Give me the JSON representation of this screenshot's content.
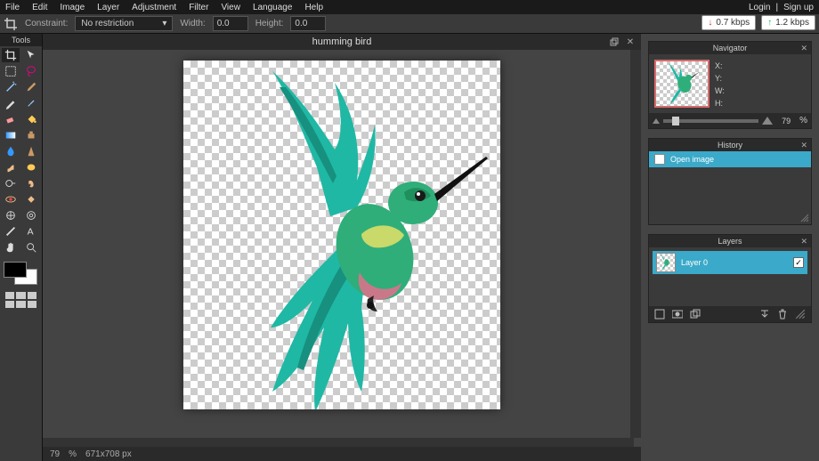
{
  "menu": {
    "items": [
      "File",
      "Edit",
      "Image",
      "Layer",
      "Adjustment",
      "Filter",
      "View",
      "Language",
      "Help"
    ],
    "login": "Login",
    "signup": "Sign up",
    "sep": "|"
  },
  "optionbar": {
    "constraint_label": "Constraint:",
    "constraint_value": "No restriction",
    "width_label": "Width:",
    "width_value": "0.0",
    "height_label": "Height:",
    "height_value": "0.0",
    "down_rate": "0.7 kbps",
    "up_rate": "1.2 kbps"
  },
  "tools": {
    "title": "Tools",
    "items": [
      "crop",
      "move",
      "marquee",
      "lasso",
      "wand",
      "eyedropper",
      "pencil",
      "brush",
      "eraser",
      "paint-bucket",
      "gradient",
      "clone",
      "blur",
      "sharpen",
      "smudge",
      "sponge",
      "dodge",
      "burn",
      "red-eye",
      "spot-heal",
      "bloat",
      "pinch",
      "type",
      "hand",
      "colorpicker",
      "zoom"
    ]
  },
  "document": {
    "title": "humming bird",
    "zoom": "79",
    "zoom_pct": "%",
    "dimensions": "671x708 px"
  },
  "navigator": {
    "title": "Navigator",
    "x": "X:",
    "y": "Y:",
    "w": "W:",
    "h": "H:",
    "zoom_value": "79",
    "pct": "%"
  },
  "history": {
    "title": "History",
    "items": [
      "Open image"
    ]
  },
  "layers": {
    "title": "Layers",
    "rows": [
      {
        "name": "Layer 0",
        "visible": true
      }
    ]
  }
}
